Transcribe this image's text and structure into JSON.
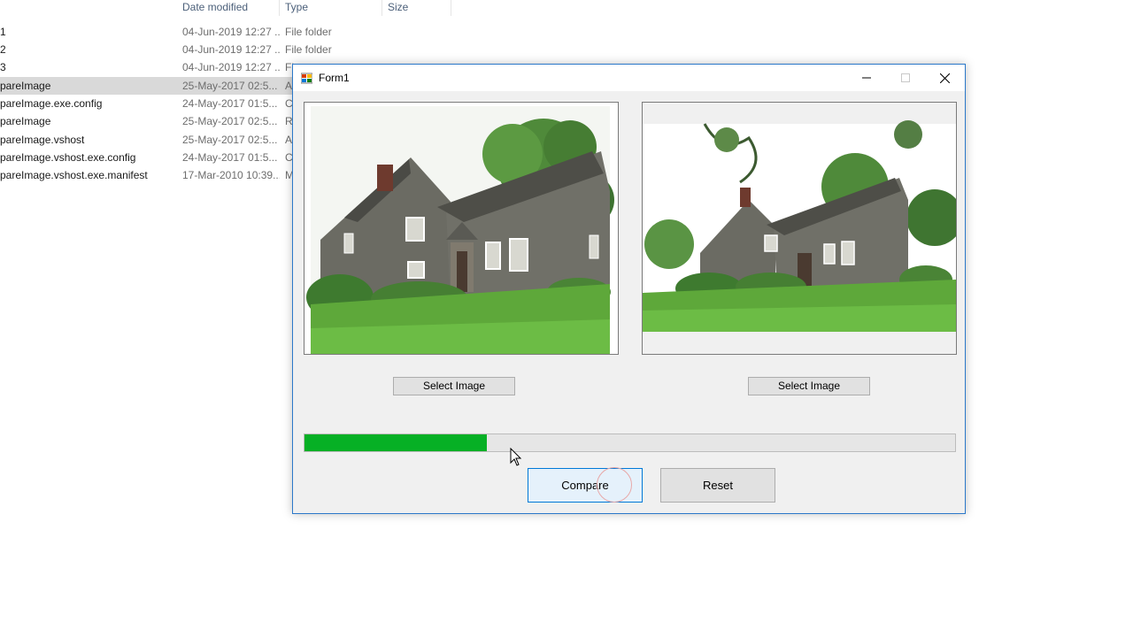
{
  "explorer": {
    "columns": {
      "date": "Date modified",
      "type": "Type",
      "size": "Size"
    },
    "rows": [
      {
        "name": "1",
        "date": "04-Jun-2019 12:27 ...",
        "type": "File folder"
      },
      {
        "name": "2",
        "date": "04-Jun-2019 12:27 ...",
        "type": "File folder"
      },
      {
        "name": "3",
        "date": "04-Jun-2019 12:27 ...",
        "type": "Fi"
      },
      {
        "name": "pareImage",
        "date": "25-May-2017 02:5...",
        "type": "A"
      },
      {
        "name": "pareImage.exe.config",
        "date": "24-May-2017 01:5...",
        "type": "C"
      },
      {
        "name": "pareImage",
        "date": "25-May-2017 02:5...",
        "type": "R"
      },
      {
        "name": "pareImage.vshost",
        "date": "25-May-2017 02:5...",
        "type": "A"
      },
      {
        "name": "pareImage.vshost.exe.config",
        "date": "24-May-2017 01:5...",
        "type": "C"
      },
      {
        "name": "pareImage.vshost.exe.manifest",
        "date": "17-Mar-2010 10:39...",
        "type": "M"
      }
    ]
  },
  "form": {
    "title": "Form1",
    "select_image_1": "Select Image",
    "select_image_2": "Select Image",
    "compare_label": "Compare",
    "reset_label": "Reset",
    "progress_fraction": 0.28
  },
  "colors": {
    "progress_fill": "#06b025",
    "compare_border": "#0078d7",
    "window_border": "#2b78c9"
  },
  "icons": {
    "minimize": "minimize-icon",
    "maximize": "maximize-icon",
    "close": "close-icon",
    "app": "app-icon",
    "cursor": "mouse-cursor"
  }
}
